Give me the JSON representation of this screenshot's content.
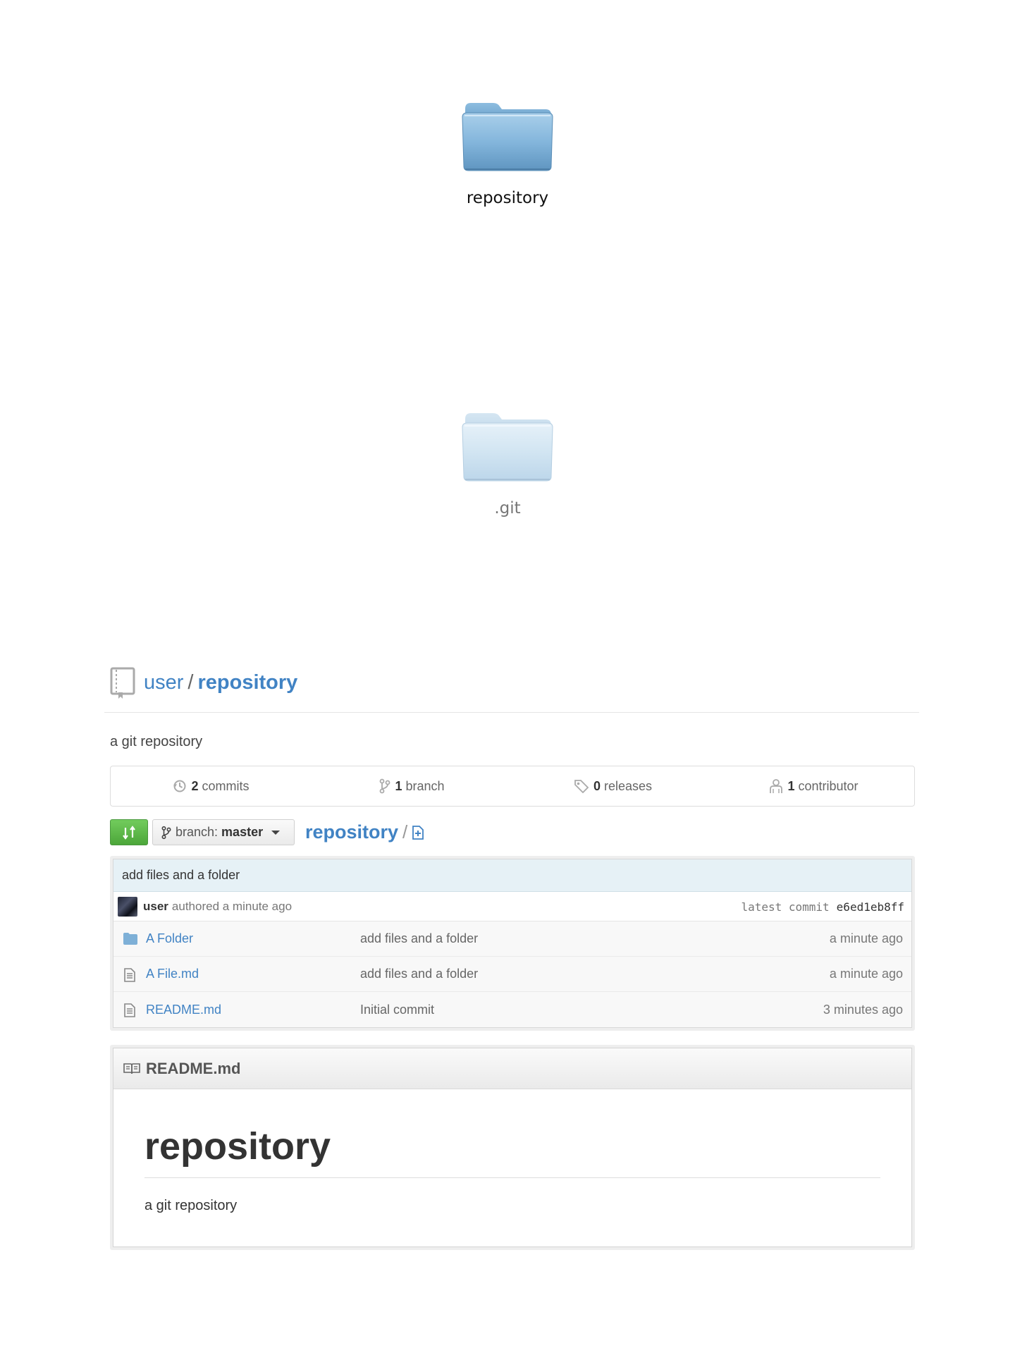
{
  "folders": [
    {
      "label": "repository",
      "icon": "folder-icon"
    },
    {
      "label": ".git",
      "icon": "folder-icon-translucent"
    }
  ],
  "header": {
    "owner": "user",
    "separator": "/",
    "repo": "repository",
    "icon": "repo-book-icon"
  },
  "description": "a git repository",
  "stats": [
    {
      "icon": "history-icon",
      "count": "2",
      "label": "commits"
    },
    {
      "icon": "branch-icon",
      "count": "1",
      "label": "branch"
    },
    {
      "icon": "tag-icon",
      "count": "0",
      "label": "releases"
    },
    {
      "icon": "contributors-icon",
      "count": "1",
      "label": "contributor"
    }
  ],
  "nav": {
    "compare_icon": "compare-icon",
    "branch_prefix": "branch:",
    "branch_name": "master",
    "breadcrumb_repo": "repository",
    "breadcrumb_sep": "/",
    "add_file_icon": "add-file-icon"
  },
  "latest_commit": {
    "message": "add files and a folder",
    "author": "user",
    "authored_text": "authored a minute ago",
    "sha_label": "latest commit",
    "sha": "e6ed1eb8ff"
  },
  "files": [
    {
      "type": "folder",
      "icon": "directory-icon",
      "name": "A Folder",
      "message": "add files and a folder",
      "age": "a minute ago"
    },
    {
      "type": "file",
      "icon": "file-text-icon",
      "name": "A File.md",
      "message": "add files and a folder",
      "age": "a minute ago"
    },
    {
      "type": "file",
      "icon": "file-text-icon",
      "name": "README.md",
      "message": "Initial commit",
      "age": "3 minutes ago"
    }
  ],
  "readme": {
    "icon": "book-icon",
    "filename": "README.md",
    "heading": "repository",
    "paragraph": "a git repository"
  },
  "colors": {
    "link": "#4183c4",
    "commit_bar": "#e6f1f6",
    "compare_button": "#5cb84a",
    "folder_blue": "#7eb0d7"
  }
}
